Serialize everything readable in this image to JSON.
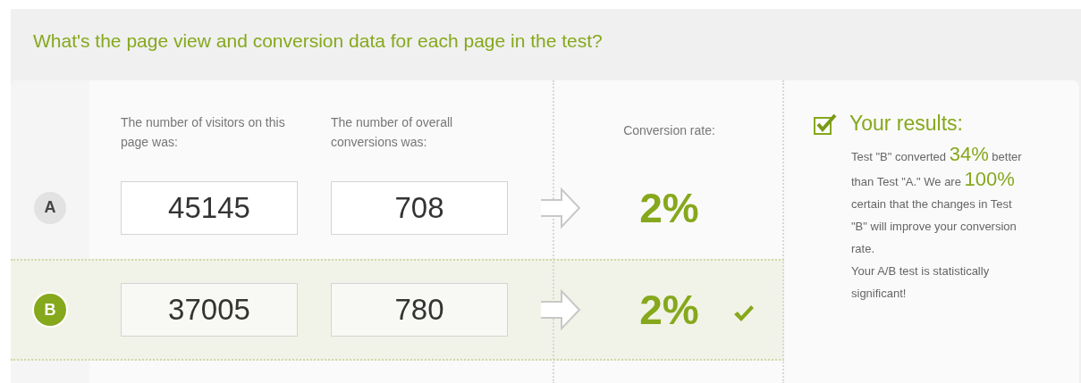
{
  "question": "What's the page view and conversion data for each page in the test?",
  "columns": {
    "visitors": "The number of visitors on this page was:",
    "conversions": "The number of overall conversions was:",
    "rate": "Conversion rate:"
  },
  "variants": [
    {
      "label": "A",
      "visitors": "45145",
      "conversions": "708",
      "rate": "2%",
      "winner": false
    },
    {
      "label": "B",
      "visitors": "37005",
      "conversions": "780",
      "rate": "2%",
      "winner": true
    }
  ],
  "results": {
    "title": "Your results:",
    "checked": true,
    "summary": [
      {
        "text": "Test \"B\" converted ",
        "emphasis": false
      },
      {
        "text": "34%",
        "emphasis": true
      },
      {
        "text": " better than Test \"A.\" We are ",
        "emphasis": false
      },
      {
        "text": "100%",
        "emphasis": true
      },
      {
        "text": " certain that the changes in Test \"B\" will improve your conversion rate.",
        "emphasis": false
      }
    ],
    "verdict": "Your A/B test is statistically significant!"
  }
}
